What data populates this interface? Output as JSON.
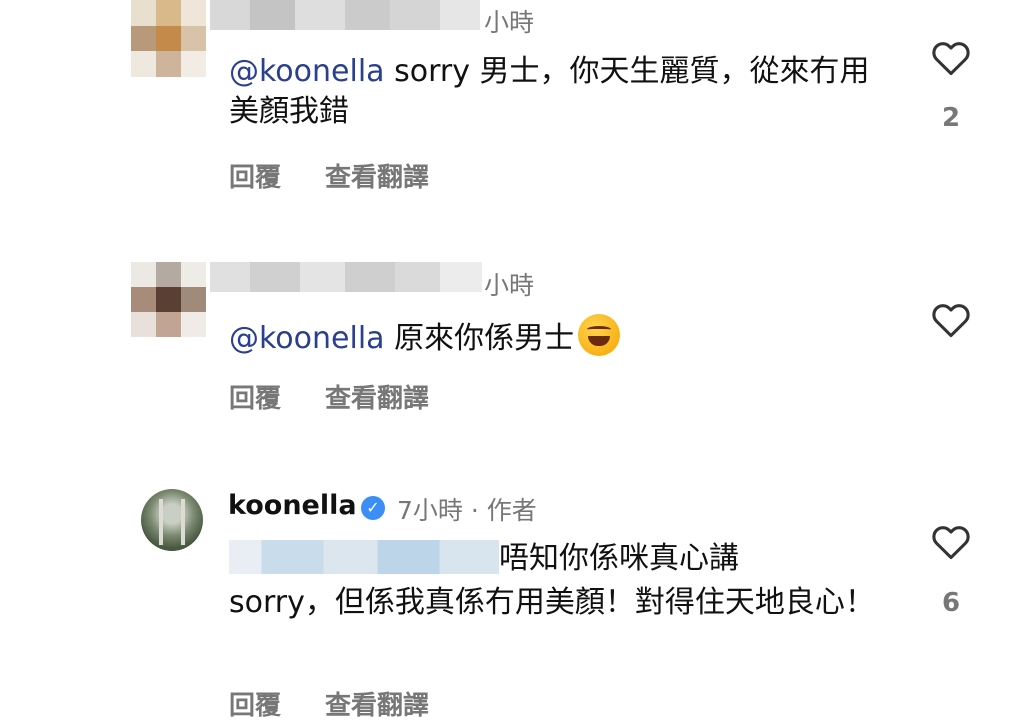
{
  "comments": [
    {
      "time": "小時",
      "mention": "@koonella",
      "text": " sorry 男士，你天生麗質，從來冇用美顏我錯",
      "reply_label": "回覆",
      "translate_label": "查看翻譯",
      "likes": "2"
    },
    {
      "time": "小時",
      "mention": "@koonella",
      "text": " 原來你係男士",
      "emoji": "rolling-on-floor-laughing",
      "reply_label": "回覆",
      "translate_label": "查看翻譯",
      "likes": ""
    },
    {
      "username": "koonella",
      "time": "7小時",
      "separator": "·",
      "author_badge": "作者",
      "text_line1": "唔知你係咪真心講",
      "text_rest": "sorry，但係我真係冇用美顏！對得住天地良心！",
      "reply_label": "回覆",
      "translate_label": "查看翻譯",
      "likes": "6"
    }
  ],
  "icons": {
    "like": "heart-outline-icon",
    "verified": "verified-badge-icon"
  },
  "colors": {
    "mention": "#2a3f8f",
    "secondary_text": "#777777",
    "verified": "#3a8ef5"
  }
}
